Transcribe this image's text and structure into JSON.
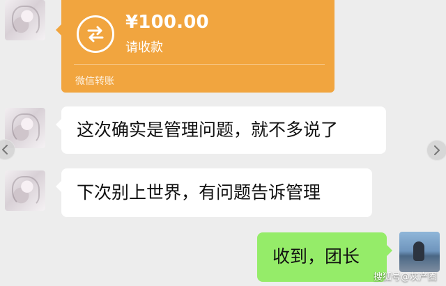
{
  "transfer": {
    "amount": "¥100.00",
    "status": "请收款",
    "footer": "微信转账",
    "icon": "transfer-arrows-icon"
  },
  "messages": [
    {
      "sender": "left",
      "text": "这次确实是管理问题，就不多说了"
    },
    {
      "sender": "left",
      "text": "下次别上世界，有问题告诉管理"
    },
    {
      "sender": "right",
      "text": "收到，团长"
    }
  ],
  "navigation": {
    "left_icon": "chevron-left-icon",
    "right_icon": "chevron-right-icon"
  },
  "watermark": "搜狐号@灰产圈",
  "colors": {
    "background": "#ededed",
    "transfer_card": "#f1a53f",
    "incoming_bubble": "#ffffff",
    "outgoing_bubble": "#95ec69",
    "text": "#111111"
  }
}
